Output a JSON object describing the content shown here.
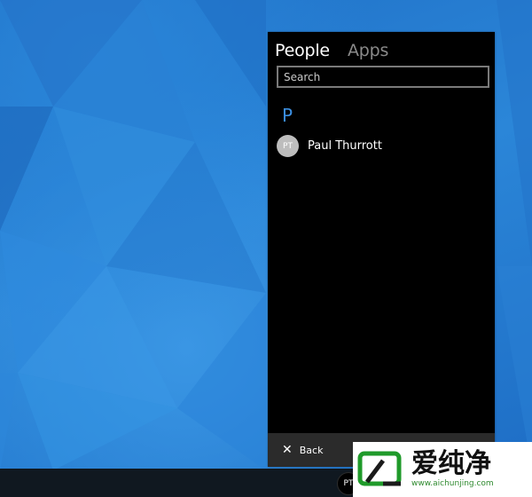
{
  "people_panel": {
    "tabs": [
      {
        "label": "People",
        "active": true
      },
      {
        "label": "Apps",
        "active": false
      }
    ],
    "search": {
      "placeholder": "Search",
      "value": ""
    },
    "group_letter": "P",
    "contacts": [
      {
        "initials": "PT",
        "name": "Paul Thurrott"
      }
    ],
    "footer": {
      "back_label": "Back",
      "back_icon": "close-icon"
    }
  },
  "taskbar": {
    "people_button_initials": "PT"
  },
  "watermark": {
    "title": "爱纯净",
    "url": "www.aichunjing.com"
  },
  "colors": {
    "accent": "#3b8ee0",
    "panel_bg": "#000000",
    "footer_bg": "#2b2b2b",
    "desktop_blue": "#2b86d8",
    "watermark_green": "#2f8a2f"
  }
}
